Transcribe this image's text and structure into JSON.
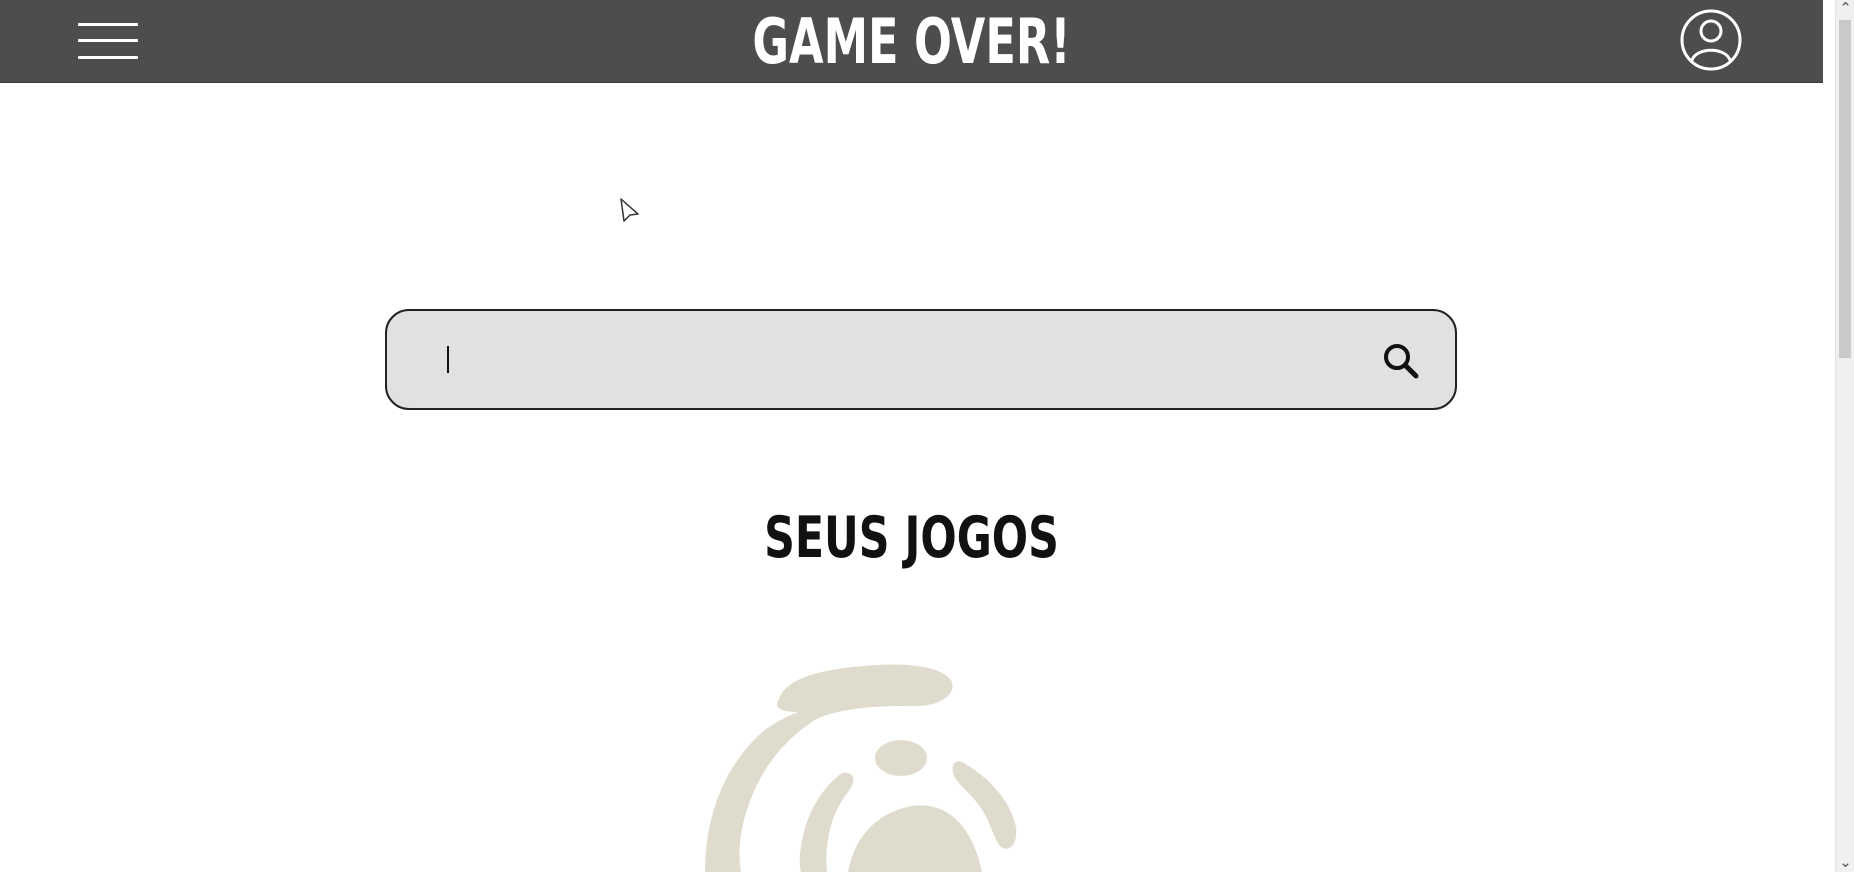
{
  "header": {
    "title": "GAME OVER!",
    "background_color": "#4d4d4d",
    "text_color": "#ffffff",
    "menu_icon": "hamburger-menu-icon",
    "user_icon": "user-account-icon"
  },
  "search": {
    "value": "",
    "placeholder": "",
    "icon": "search-icon",
    "background_color": "#e1e1e1",
    "border_color": "#222222"
  },
  "content": {
    "section_title": "SEUS JOGOS",
    "emblem_icon": "game-emblem-icon",
    "emblem_color": "#dfdccd"
  },
  "scrollbar": {
    "up_icon": "chevron-up-icon",
    "down_icon": "chevron-down-icon"
  }
}
